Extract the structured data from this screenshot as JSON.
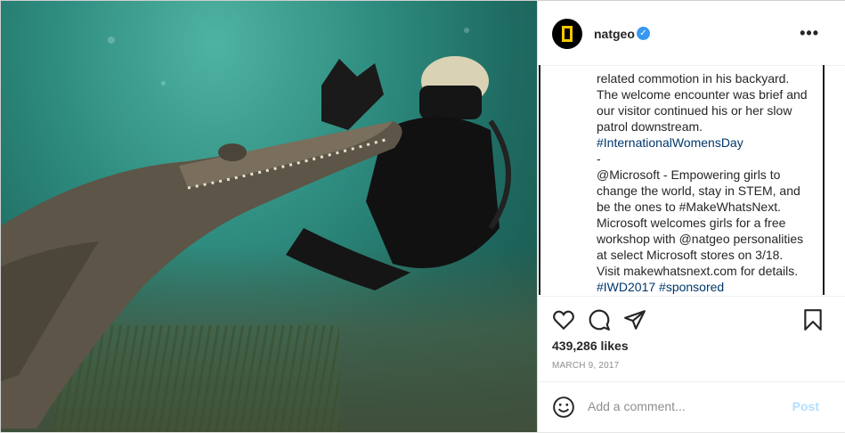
{
  "header": {
    "username": "natgeo",
    "verified_mark": "✓",
    "more_label": "•••"
  },
  "caption": {
    "lines": [
      "related commotion in his backyard.",
      "The welcome encounter was brief and",
      "our visitor continued his or her slow",
      "patrol downstream.",
      "#InternationalWomensDay",
      "-",
      "@Microsoft - Empowering girls to",
      "change the world, stay in STEM, and",
      "be the ones to #MakeWhatsNext.",
      "Microsoft welcomes girls for a free",
      "workshop with @natgeo personalities",
      "at select Microsoft stores on 3/18.",
      "Visit makewhatsnext.com for details.",
      "#IWD2017 #sponsored"
    ]
  },
  "actions": {
    "like_icon": "heart-icon",
    "comment_icon": "comment-icon",
    "share_icon": "share-icon",
    "save_icon": "bookmark-icon"
  },
  "likes": "439,286 likes",
  "date": "MARCH 9, 2017",
  "comment": {
    "placeholder": "Add a comment...",
    "post_label": "Post",
    "emoji_icon": "smiley-icon"
  },
  "colors": {
    "link": "#00376b",
    "post_disabled": "#b2dffc",
    "verified": "#3897f0"
  }
}
